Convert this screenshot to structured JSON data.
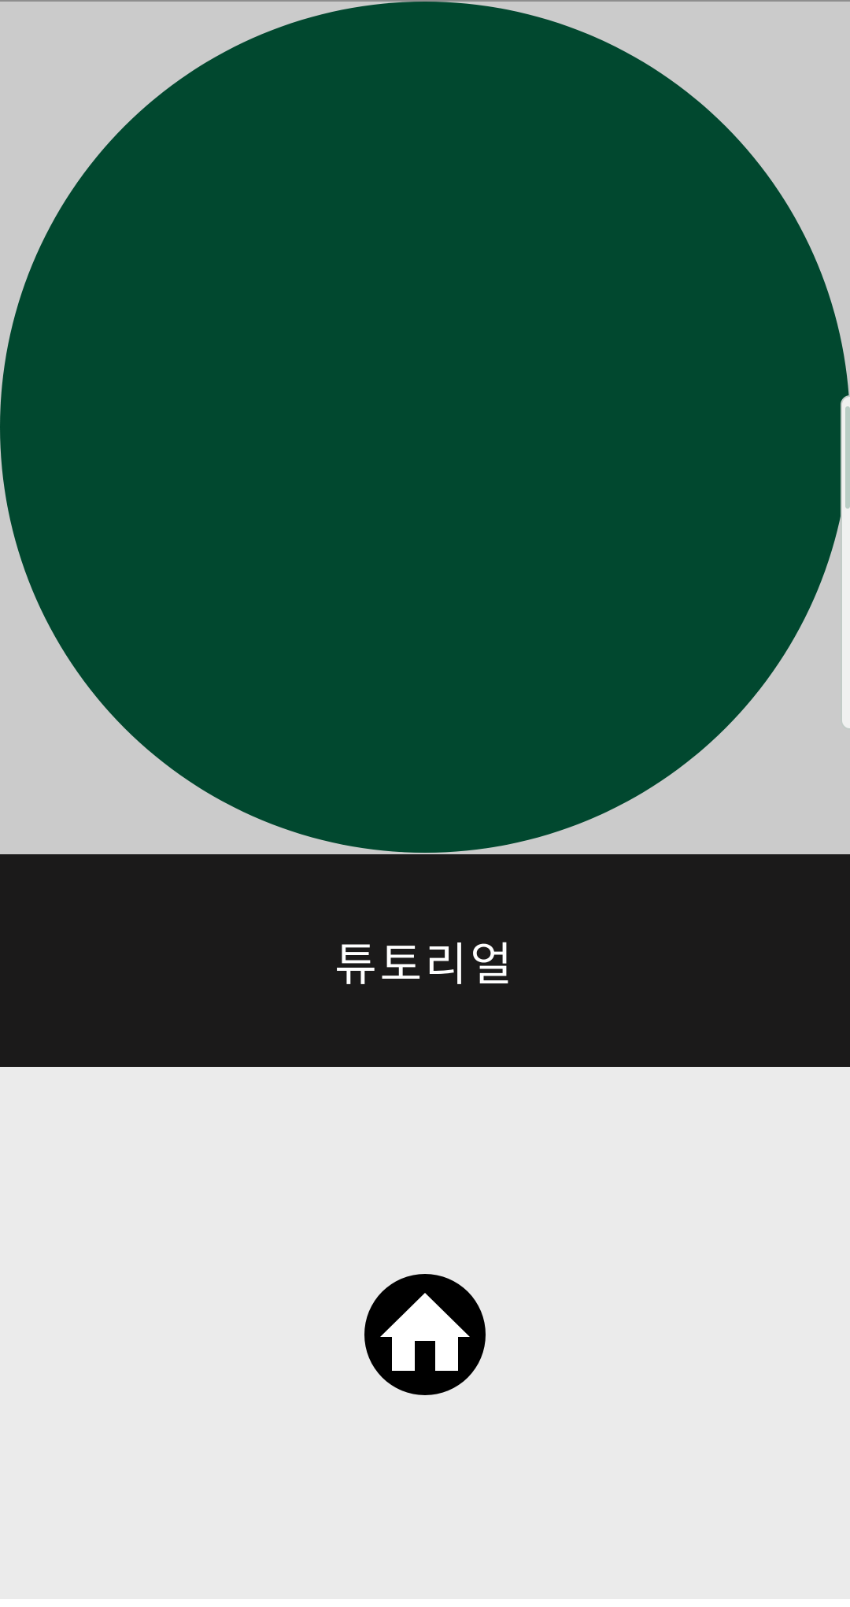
{
  "title": "튜토리얼",
  "icons": {
    "home": "home-icon"
  },
  "colors": {
    "shape_green": "#01482f",
    "top_background": "#cbcbcb",
    "title_bar_background": "#1b1a1a",
    "title_text": "#ffffff",
    "bottom_background": "#ebebeb",
    "home_icon": "#000000"
  }
}
